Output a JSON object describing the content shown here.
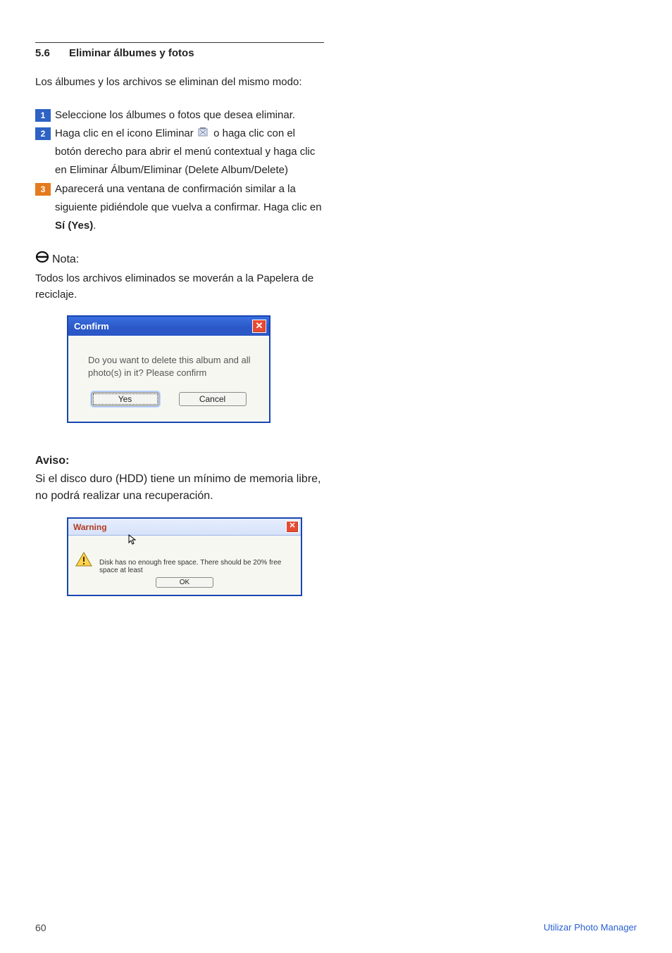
{
  "section": {
    "number": "5.6",
    "title": "Eliminar álbumes y fotos"
  },
  "intro": "Los álbumes y los archivos se eliminan del mismo modo:",
  "steps": {
    "s1": "Seleccione los álbumes o fotos que desea eliminar.",
    "s2a": "Haga clic en el icono Eliminar ",
    "s2b": " o haga clic con el botón derecho para abrir el menú contextual y haga clic en Eliminar Álbum/Eliminar (Delete Album/Delete)",
    "s3a": "Aparecerá una ventana de confirmación similar a la siguiente pidiéndole que vuelva a confirmar. Haga clic en ",
    "s3bold": "Sí (Yes)",
    "s3b": "."
  },
  "note": {
    "heading": "Nota:",
    "body": "Todos los archivos eliminados se moverán a la Papelera de reciclaje."
  },
  "confirm_dialog": {
    "title": "Confirm",
    "message": "Do you want to delete this album and all photo(s) in it? Please confirm",
    "yes": "Yes",
    "cancel": "Cancel"
  },
  "aviso": {
    "heading": "Aviso:",
    "body": "Si el disco duro (HDD) tiene un mínimo de memoria libre, no podrá realizar una recuperación."
  },
  "warning_dialog": {
    "title": "Warning",
    "message": "Disk has no enough free space. There should be 20%  free space at least",
    "ok": "OK"
  },
  "footer": {
    "page": "60",
    "label": "Utilizar Photo Manager"
  }
}
